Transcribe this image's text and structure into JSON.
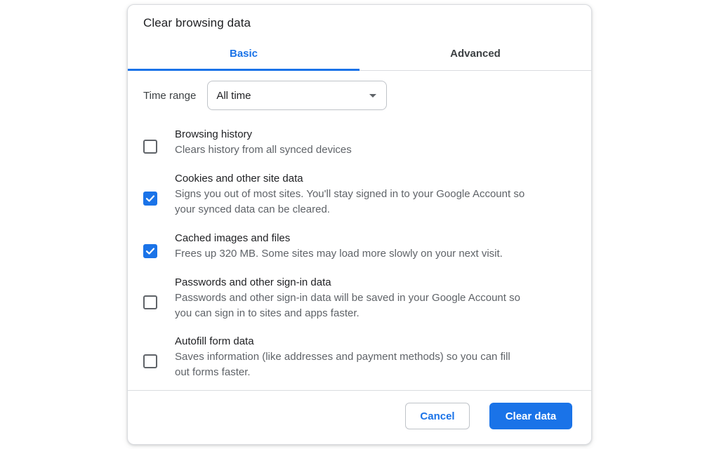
{
  "dialog": {
    "title": "Clear browsing data"
  },
  "tabs": [
    {
      "label": "Basic",
      "active": true
    },
    {
      "label": "Advanced",
      "active": false
    }
  ],
  "time_range": {
    "label": "Time range",
    "selected": "All time"
  },
  "options": [
    {
      "title": "Browsing history",
      "description": [
        "Clears history from all synced devices"
      ],
      "checked": false
    },
    {
      "title": "Cookies and other site data",
      "description": [
        "Signs you out of most sites. You'll stay signed in to your Google Account so",
        "your synced data can be cleared."
      ],
      "checked": true
    },
    {
      "title": "Cached images and files",
      "description": [
        "Frees up 320 MB. Some sites may load more slowly on your next visit."
      ],
      "checked": true
    },
    {
      "title": "Passwords and other sign-in data",
      "description": [
        "Passwords and other sign-in data will be saved in your Google Account so",
        "you can sign in to sites and apps faster."
      ],
      "checked": false
    },
    {
      "title": "Autofill form data",
      "description": [
        "Saves information (like addresses and payment methods) so you can fill",
        "out forms faster."
      ],
      "checked": false
    }
  ],
  "buttons": {
    "cancel": "Cancel",
    "clear": "Clear data"
  },
  "colors": {
    "accent": "#1a73e8",
    "text_primary": "#202124",
    "text_secondary": "#5f6368",
    "divider": "#dadce0"
  },
  "icons": {
    "checkbox_checked": "checkmark-icon",
    "dropdown": "caret-down-icon"
  }
}
